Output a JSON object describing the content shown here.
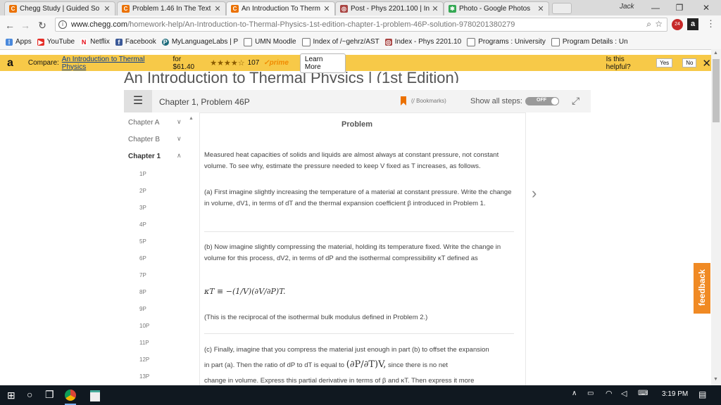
{
  "browser": {
    "tabs": [
      {
        "title": "Chegg Study | Guided So",
        "icon": "chegg-icon",
        "color": "#eb7100"
      },
      {
        "title": "Problem 1.46 In The Text",
        "icon": "chegg-icon",
        "color": "#eb7100"
      },
      {
        "title": "An Introduction To Therm",
        "icon": "chegg-icon",
        "color": "#eb7100",
        "active": true
      },
      {
        "title": "Post - Phys 2201.100 | In",
        "icon": "canvas-icon",
        "color": "#a94442"
      },
      {
        "title": "Photo - Google Photos",
        "icon": "google-photos-icon",
        "color": "#34a853"
      }
    ],
    "profile_name": "Jack",
    "url_host": "www.chegg.com",
    "url_path": "/homework-help/An-Introduction-to-Thermal-Physics-1st-edition-chapter-1-problem-46P-solution-9780201380279",
    "ext_badge": "24",
    "bookmarks": [
      {
        "label": "Apps",
        "icon": "apps-grid-icon"
      },
      {
        "label": "YouTube",
        "icon": "youtube-icon"
      },
      {
        "label": "Netflix",
        "icon": "netflix-icon"
      },
      {
        "label": "Facebook",
        "icon": "facebook-icon"
      },
      {
        "label": "MyLanguageLabs | P",
        "icon": "pearson-icon"
      },
      {
        "label": "UMN Moodle",
        "icon": "page-icon"
      },
      {
        "label": "Index of /~gehrz/AST",
        "icon": "page-icon"
      },
      {
        "label": "Index - Phys 2201.10",
        "icon": "canvas-icon"
      },
      {
        "label": "Programs : University",
        "icon": "page-icon"
      },
      {
        "label": "Program Details : Un",
        "icon": "page-icon"
      }
    ]
  },
  "banner": {
    "compare": "Compare:",
    "link": "An Introduction to Thermal Physics",
    "price_text": "for $61.40",
    "stars": "★★★★",
    "rating_count": "107",
    "prime": "prime",
    "learn_more": "Learn More",
    "helpful": "Is this helpful?",
    "yes": "Yes",
    "no": "No"
  },
  "page": {
    "book_title": "An Introduction to Thermal Physics | (1st Edition)",
    "chapter_problem": "Chapter 1, Problem 46P",
    "bookmarks": "(/ Bookmarks)",
    "show_all_steps": "Show all steps:",
    "toggle": "OFF",
    "problem_heading": "Problem"
  },
  "sidebar": {
    "chapters": [
      "Chapter A",
      "Chapter B",
      "Chapter 1"
    ],
    "problems": [
      "1P",
      "2P",
      "3P",
      "4P",
      "5P",
      "6P",
      "7P",
      "8P",
      "9P",
      "10P",
      "11P",
      "12P",
      "13P"
    ]
  },
  "problem": {
    "intro": "Measured heat capacities of solids and liquids are almost always at constant pressure, not constant volume. To see why, estimate the pressure needed to keep V fixed as T increases, as follows.",
    "part_a": "(a) First imagine slightly increasing the temperature of a material at constant pressure. Write the change in volume, dV1, in terms of dT and the thermal expansion coefficient β introduced in Problem 1.",
    "part_b": "(b) Now imagine slightly compressing the material, holding its temperature fixed. Write the change in volume for this process, dV2, in terms of dP and the isothermal compressibility κT defined as",
    "equation": "κT ≡ −(1/V)(∂V/∂P)T.",
    "reciprocal": "(This is the reciprocal of the isothermal bulk modulus defined in Problem 2.)",
    "part_c_1": "(c) Finally, imagine that you compress the material just enough in part (b) to offset the expansion",
    "part_c_2": "in part (a). Then the ratio of dP to dT is equal to",
    "part_c_math": "(∂P/∂T)V,",
    "part_c_3": "since there is no net",
    "part_c_4": "change in volume. Express this partial derivative in terms of β and κT. Then express it more"
  },
  "feedback": "feedback",
  "taskbar": {
    "time": "3:19 PM"
  }
}
